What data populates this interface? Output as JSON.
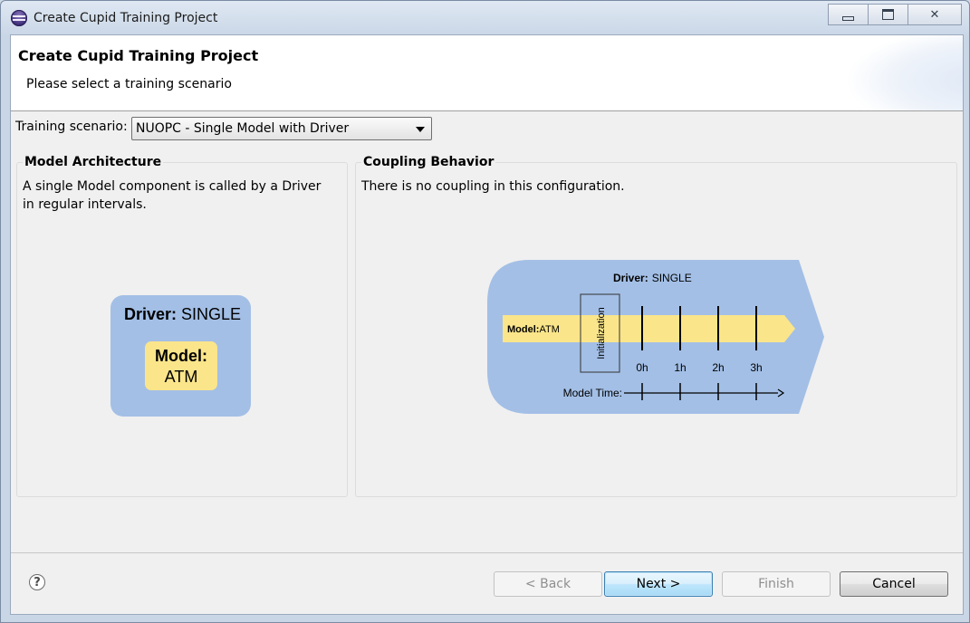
{
  "window": {
    "title": "Create Cupid Training Project",
    "icon": "eclipse-icon"
  },
  "banner": {
    "title": "Create Cupid Training Project",
    "subtitle": "Please select a training scenario"
  },
  "scenario": {
    "label": "Training scenario:",
    "selected": "NUOPC - Single Model with Driver"
  },
  "model_architecture": {
    "title": "Model Architecture",
    "description": "A single Model component is called by a Driver in regular intervals.",
    "figure": {
      "driver_label": "Driver:",
      "driver_name": "SINGLE",
      "model_label": "Model:",
      "model_name": "ATM"
    }
  },
  "coupling_behavior": {
    "title": "Coupling Behavior",
    "description": "There is no coupling in this configuration.",
    "figure": {
      "driver_label": "Driver:",
      "driver_name": "SINGLE",
      "model_label": "Model:",
      "model_name": "ATM",
      "init_label": "Initialization",
      "time_ticks": [
        "0h",
        "1h",
        "2h",
        "3h"
      ],
      "time_axis_label": "Model Time:"
    }
  },
  "buttons": {
    "help": "?",
    "back": "< Back",
    "next": "Next >",
    "finish": "Finish",
    "cancel": "Cancel"
  },
  "colors": {
    "driver_blue": "#a3bfe6",
    "model_yellow": "#fae58a",
    "default_button_border": "#3c7fb1"
  }
}
